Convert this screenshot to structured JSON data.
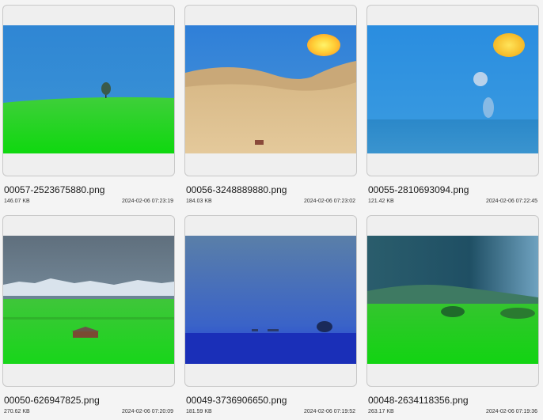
{
  "gallery": {
    "items": [
      {
        "filename": "00057-2523675880.png",
        "size": "146.07 KB",
        "date": "2024-02-06 07:23:19",
        "scene": "green-hill-tree"
      },
      {
        "filename": "00056-3248889880.png",
        "size": "184.03 KB",
        "date": "2024-02-06 07:23:02",
        "scene": "desert-dunes-sun"
      },
      {
        "filename": "00055-2810693094.png",
        "size": "121.42 KB",
        "date": "2024-02-06 07:22:45",
        "scene": "ocean-sun-moon"
      },
      {
        "filename": "00050-626947825.png",
        "size": "270.62 KB",
        "date": "2024-02-06 07:20:09",
        "scene": "meadow-cabin-mountains"
      },
      {
        "filename": "00049-3736906650.png",
        "size": "181.59 KB",
        "date": "2024-02-06 07:19:52",
        "scene": "blue-fog-field-tree"
      },
      {
        "filename": "00048-2634118356.png",
        "size": "263.17 KB",
        "date": "2024-02-06 07:19:36",
        "scene": "storm-green-field-trees"
      }
    ]
  },
  "colors": {
    "background": "#f4f4f4",
    "card_border": "#c8c8c8",
    "card_fill": "#efefef"
  }
}
